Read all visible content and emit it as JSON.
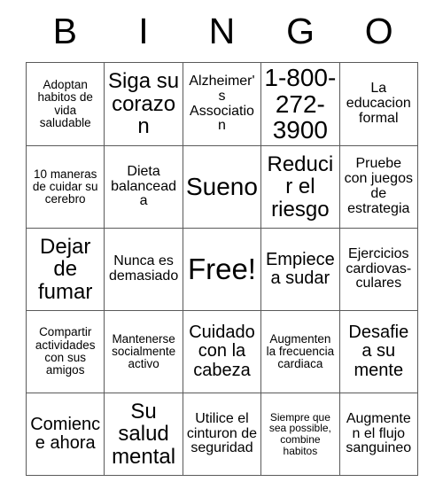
{
  "card": {
    "header_letters": [
      "B",
      "I",
      "N",
      "G",
      "O"
    ],
    "free_space": {
      "row": 2,
      "col": 2,
      "label": "Free!"
    },
    "grid": [
      [
        {
          "text": "Adoptan habitos de vida saludable",
          "size": "sm"
        },
        {
          "text": "Siga su corazon",
          "size": "xl"
        },
        {
          "text": "Alzheimer's Association",
          "size": "md"
        },
        {
          "text": "1-800-272-3900",
          "size": "xxl"
        },
        {
          "text": "La educacion formal",
          "size": "md"
        }
      ],
      [
        {
          "text": "10 maneras de cuidar su cerebro",
          "size": "sm"
        },
        {
          "text": "Dieta balanceada",
          "size": "md"
        },
        {
          "text": "Sueno",
          "size": "xxl"
        },
        {
          "text": "Reducir el riesgo",
          "size": "xl"
        },
        {
          "text": "Pruebe con juegos de estrategia",
          "size": "md"
        }
      ],
      [
        {
          "text": "Dejar de fumar",
          "size": "xl"
        },
        {
          "text": "Nunca es demasiado",
          "size": "md"
        },
        {
          "text": "Free!",
          "size": "free"
        },
        {
          "text": "Empiece a sudar",
          "size": "lg"
        },
        {
          "text": "Ejercicios cardiovas-culares",
          "size": "md"
        }
      ],
      [
        {
          "text": "Compartir actividades con sus amigos",
          "size": "sm"
        },
        {
          "text": "Mantenerse socialmente activo",
          "size": "sm"
        },
        {
          "text": "Cuidado con la cabeza",
          "size": "lg"
        },
        {
          "text": "Augmenten la frecuencia cardiaca",
          "size": "sm"
        },
        {
          "text": "Desafie a su mente",
          "size": "lg"
        }
      ],
      [
        {
          "text": "Comience ahora",
          "size": "lg"
        },
        {
          "text": "Su salud mental",
          "size": "xl"
        },
        {
          "text": "Utilice el cinturon de seguridad",
          "size": "md"
        },
        {
          "text": "Siempre que sea possible, combine habitos",
          "size": "xs"
        },
        {
          "text": "Augmenten el flujo sanguineo",
          "size": "md"
        }
      ]
    ]
  },
  "colors": {
    "background": "#ffffff",
    "text": "#000000",
    "grid_line": "#5a5a5a"
  }
}
